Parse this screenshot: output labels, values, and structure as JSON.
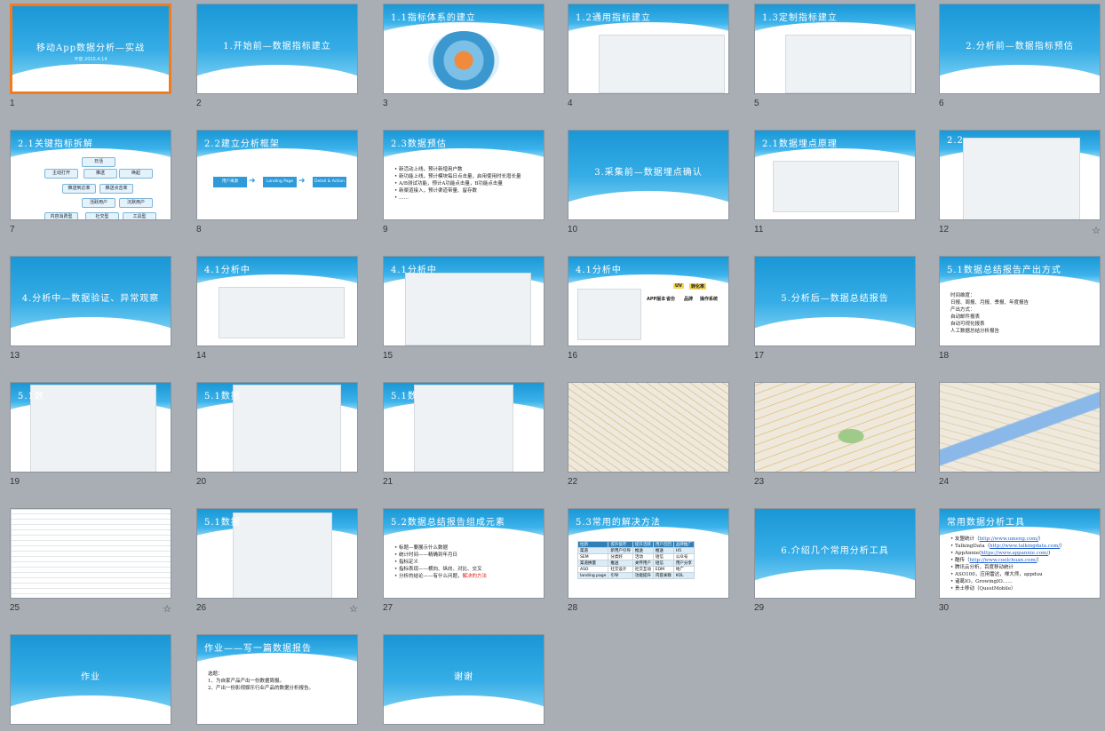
{
  "slides": [
    {
      "n": "1",
      "kind": "cover",
      "title": "移动App数据分析—实战",
      "subtitle": "平泉 2015.4.14",
      "selected": true
    },
    {
      "n": "2",
      "kind": "section",
      "title": "1.开始前—数据指标建立"
    },
    {
      "n": "3",
      "kind": "banner",
      "title": "1.1指标体系的建立",
      "content": "diagram-circles"
    },
    {
      "n": "4",
      "kind": "banner",
      "title": "1.2通用指标建立",
      "content": "table"
    },
    {
      "n": "5",
      "kind": "banner",
      "title": "1.3定制指标建立",
      "content": "table"
    },
    {
      "n": "6",
      "kind": "section",
      "title": "2.分析前—数据指标预估"
    },
    {
      "n": "7",
      "kind": "banner",
      "title": "2.1关键指标拆解",
      "content": "tree",
      "nodes": [
        "日活",
        "主动打开",
        "推送",
        "唤起",
        "推送到达率",
        "推送点击率",
        "活跃用户",
        "沉默用户",
        "内容消费型",
        "社交型",
        "工具型"
      ]
    },
    {
      "n": "8",
      "kind": "banner",
      "title": "2.2建立分析框架",
      "content": "flow",
      "steps": [
        "用户来源",
        "Landing Page",
        "Detail & Action"
      ]
    },
    {
      "n": "9",
      "kind": "banner",
      "title": "2.3数据预估",
      "content": "bullets",
      "lines": [
        "新活动上线，预计新增用户数",
        "新功能上线，预计模块每日点击量，启用使用时长增长量",
        "A/B测试功能，预计A功能点击量，B功能点击量",
        "新渠道接入，预计渠道带量、留存数",
        "……"
      ]
    },
    {
      "n": "10",
      "kind": "section",
      "title": "3.采集前—数据埋点确认"
    },
    {
      "n": "11",
      "kind": "banner",
      "title": "2.1数据埋点原理",
      "content": "diagram-phone"
    },
    {
      "n": "12",
      "kind": "banner",
      "title": "2.2",
      "content": "screenshot",
      "star": true
    },
    {
      "n": "13",
      "kind": "section",
      "title": "4.分析中—数据验证、异常观察"
    },
    {
      "n": "14",
      "kind": "banner",
      "title": "4.1分析中",
      "content": "charts"
    },
    {
      "n": "15",
      "kind": "banner",
      "title": "4.1分析中",
      "content": "charts2"
    },
    {
      "n": "16",
      "kind": "banner",
      "title": "4.1分析中",
      "content": "funnel",
      "labels": [
        "UV",
        "转化率",
        "APP版本",
        "省份",
        "品牌",
        "操作系统"
      ]
    },
    {
      "n": "17",
      "kind": "section",
      "title": "5.分析后—数据总结报告"
    },
    {
      "n": "18",
      "kind": "banner",
      "title": "5.1数据总结报告产出方式",
      "content": "bullets",
      "lines": [
        "时间维度：",
        "日报、周报、月报、季报、年度报告",
        "产出方式：",
        "自动邮件报表",
        "自动可视化报表",
        "人工数据总结分析报告"
      ]
    },
    {
      "n": "19",
      "kind": "banner",
      "title": "5.1数",
      "content": "report"
    },
    {
      "n": "20",
      "kind": "banner",
      "title": "5.1数据",
      "content": "dashboard"
    },
    {
      "n": "21",
      "kind": "banner",
      "title": "5.1数",
      "content": "donuts"
    },
    {
      "n": "22",
      "kind": "map",
      "title": ""
    },
    {
      "n": "23",
      "kind": "map",
      "title": ""
    },
    {
      "n": "24",
      "kind": "map",
      "title": ""
    },
    {
      "n": "25",
      "kind": "sheet",
      "title": "",
      "star": true
    },
    {
      "n": "26",
      "kind": "banner",
      "title": "5.1数据",
      "content": "report2",
      "star": true
    },
    {
      "n": "27",
      "kind": "banner",
      "title": "5.2数据总结报告组成元素",
      "content": "bullets",
      "lines": [
        "标题—要展示什么数据",
        "统计时间——精确到年月日",
        "指标定义",
        "指标表现——横向、纵向、对比、交叉",
        "分析的结论——有什么问题，"
      ],
      "highlight": "解决的方法"
    },
    {
      "n": "28",
      "kind": "banner",
      "title": "5.3常用的解决方法",
      "content": "methods",
      "rows": [
        [
          "拉新",
          "提升留存",
          "提升活跃",
          "用户召回",
          "品牌推广"
        ],
        [
          "渠道",
          "新用户引导",
          "推送",
          "推送",
          "H5"
        ],
        [
          "SEM",
          "分类好",
          "活动",
          "短信",
          "公众号"
        ],
        [
          "渠道换量",
          "推送",
          "关怀用户",
          "短信",
          "用户分享"
        ],
        [
          "ASO",
          "社交设计",
          "社交互动",
          "EDM",
          "地广"
        ],
        [
          "landing page",
          "引导",
          "功能提升",
          "内容关联",
          "KOL"
        ]
      ]
    },
    {
      "n": "29",
      "kind": "section",
      "title": "6.介绍几个常用分析工具"
    },
    {
      "n": "30",
      "kind": "banner",
      "title": "常用数据分析工具",
      "content": "tools",
      "lines": [
        "友盟统计（",
        "TalkingData（",
        "AppAnnie(",
        "酷传（",
        "腾讯云分析，百度移动统计",
        "ASO100，应用雷达，禅大师，appduu",
        "诸葛IO，GrowingIO……",
        "贵士移动（QuestMobile）"
      ],
      "links": [
        "http://www.umeng.com/",
        "http://www.talkingdata.com/",
        "https://www.appannie.com/",
        "http://www.coolchuan.com/"
      ]
    },
    {
      "n": "",
      "kind": "section",
      "title": "作业"
    },
    {
      "n": "",
      "kind": "banner",
      "title": "作业——写一篇数据报告",
      "content": "bullets",
      "lines": [
        "选题：",
        "1、为自家产品产出一份数据周报。",
        "2、产出一份影视娱乐行业产品的数据分析报告。"
      ]
    },
    {
      "n": "",
      "kind": "section",
      "title": "谢谢"
    }
  ]
}
